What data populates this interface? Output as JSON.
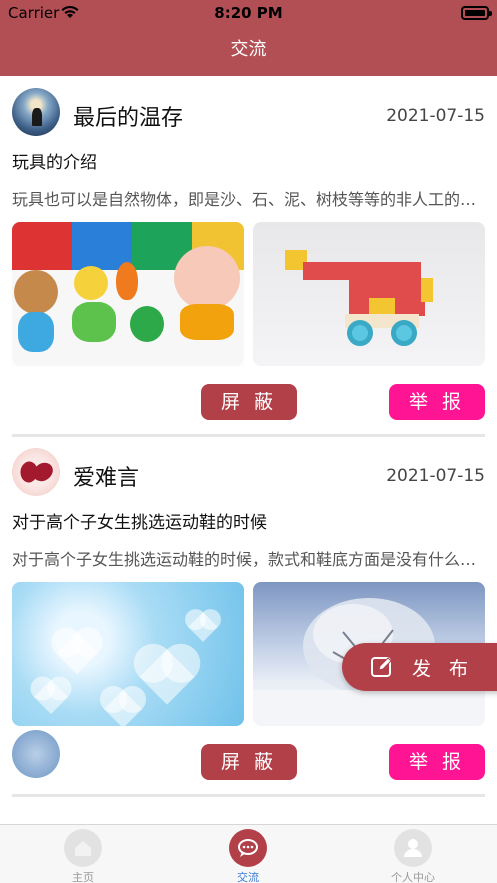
{
  "status_bar": {
    "carrier": "Carrier",
    "time": "8:20 PM"
  },
  "nav": {
    "title": "交流"
  },
  "posts": [
    {
      "username": "最后的温存",
      "date": "2021-07-15",
      "title": "玩具的介绍",
      "description": "玩具也可以是自然物体，即是沙、石、泥、树枝等等的非人工的东西",
      "images": [
        "toys-image",
        "lego-image"
      ],
      "block_label": "屏 蔽",
      "report_label": "举 报"
    },
    {
      "username": "爱难言",
      "date": "2021-07-15",
      "title": "对于高个子女生挑选运动鞋的时候",
      "description": "对于高个子女生挑选运动鞋的时候，款式和鞋底方面是没有什么限制的",
      "images": [
        "hearts-image",
        "snowy-tree-image"
      ],
      "block_label": "屏 蔽",
      "report_label": "举 报"
    }
  ],
  "fab": {
    "label": "发 布",
    "icon": "edit-icon"
  },
  "tabs": [
    {
      "label": "主页",
      "icon": "home-icon",
      "active": false
    },
    {
      "label": "交流",
      "icon": "chat-icon",
      "active": true
    },
    {
      "label": "个人中心",
      "icon": "person-icon",
      "active": false
    }
  ],
  "colors": {
    "primary": "#b24049",
    "header": "#b24f55",
    "report": "#ff1493",
    "tab_active": "#3a7bd5"
  }
}
